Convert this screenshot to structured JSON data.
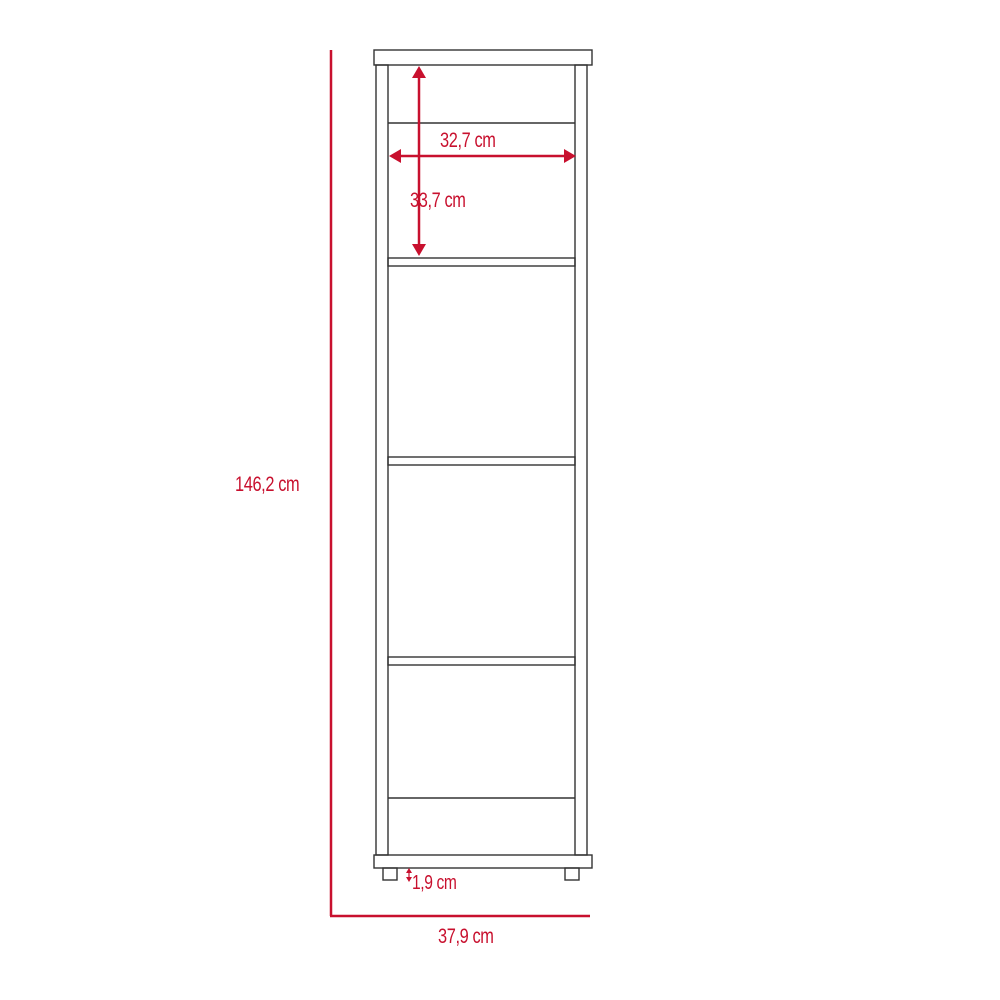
{
  "colors": {
    "dimension": "#c8102e",
    "outline": "#333333",
    "background": "#ffffff"
  },
  "dimensions": {
    "inner_width": "32,7 cm",
    "shelf_height": "33,7 cm",
    "total_height": "146,2 cm",
    "total_width": "37,9 cm",
    "feet_height": "1,9 cm"
  }
}
